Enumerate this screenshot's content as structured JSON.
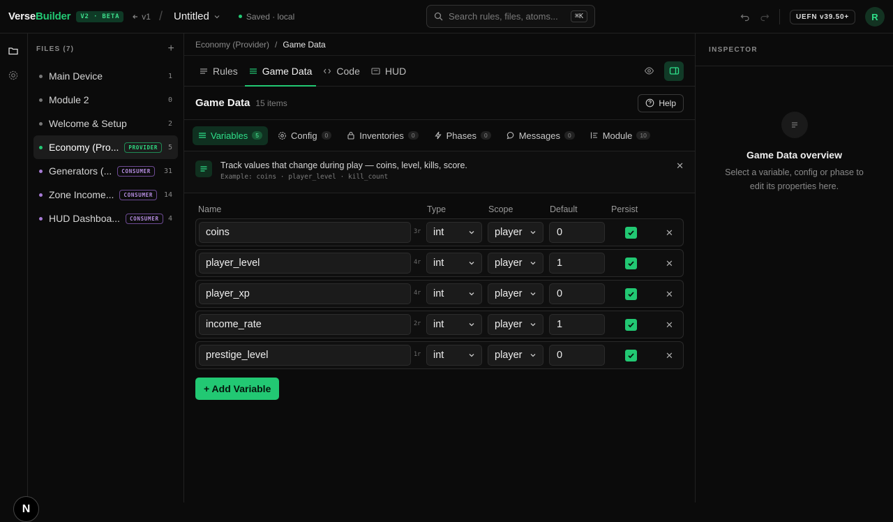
{
  "app": {
    "brand_main": "Verse",
    "brand_accent": "Builder",
    "badge": "V2 · BETA",
    "back_label": "v1",
    "doc_title": "Untitled",
    "save_status": "Saved · local",
    "search_placeholder": "Search rules, files, atoms...",
    "search_shortcut": "⌘K",
    "version_badge": "UEFN v39.50+",
    "avatar_initial": "R",
    "accent_color": "#22c873"
  },
  "rail": {
    "badge_letter": "N"
  },
  "files": {
    "header": "FILES (7)",
    "items": [
      {
        "name": "Main Device",
        "tag": "",
        "count": "1"
      },
      {
        "name": "Module 2",
        "tag": "",
        "count": "0"
      },
      {
        "name": "Welcome & Setup",
        "tag": "",
        "count": "2"
      },
      {
        "name": "Economy (Pro...",
        "tag": "PROVIDER",
        "count": "5"
      },
      {
        "name": "Generators (...",
        "tag": "CONSUMER",
        "count": "31"
      },
      {
        "name": "Zone Income...",
        "tag": "CONSUMER",
        "count": "14"
      },
      {
        "name": "HUD Dashboa...",
        "tag": "CONSUMER",
        "count": "4"
      }
    ]
  },
  "breadcrumb": {
    "parent": "Economy (Provider)",
    "current": "Game Data"
  },
  "tabs": {
    "rules": "Rules",
    "game_data": "Game Data",
    "code": "Code",
    "hud": "HUD"
  },
  "section": {
    "title": "Game Data",
    "count": "15 items",
    "help": "Help"
  },
  "subtabs": {
    "variables": {
      "label": "Variables",
      "count": "5"
    },
    "config": {
      "label": "Config",
      "count": "0"
    },
    "inventories": {
      "label": "Inventories",
      "count": "0"
    },
    "phases": {
      "label": "Phases",
      "count": "0"
    },
    "messages": {
      "label": "Messages",
      "count": "0"
    },
    "module": {
      "label": "Module",
      "count": "10"
    }
  },
  "info": {
    "title": "Track values that change during play — coins, level, kills, score.",
    "example": "Example: coins · player_level · kill_count"
  },
  "columns": {
    "name": "Name",
    "type": "Type",
    "scope": "Scope",
    "default": "Default",
    "persist": "Persist"
  },
  "variables": [
    {
      "name": "coins",
      "len": "3r",
      "type": "int",
      "scope": "player",
      "default": "0",
      "persist": true
    },
    {
      "name": "player_level",
      "len": "4r",
      "type": "int",
      "scope": "player",
      "default": "1",
      "persist": true
    },
    {
      "name": "player_xp",
      "len": "4r",
      "type": "int",
      "scope": "player",
      "default": "0",
      "persist": true
    },
    {
      "name": "income_rate",
      "len": "2r",
      "type": "int",
      "scope": "player",
      "default": "1",
      "persist": true
    },
    {
      "name": "prestige_level",
      "len": "1r",
      "type": "int",
      "scope": "player",
      "default": "0",
      "persist": true
    }
  ],
  "add_button": "+ Add Variable",
  "inspector": {
    "header": "INSPECTOR",
    "title": "Game Data overview",
    "description": "Select a variable, config or phase to edit its properties here."
  }
}
